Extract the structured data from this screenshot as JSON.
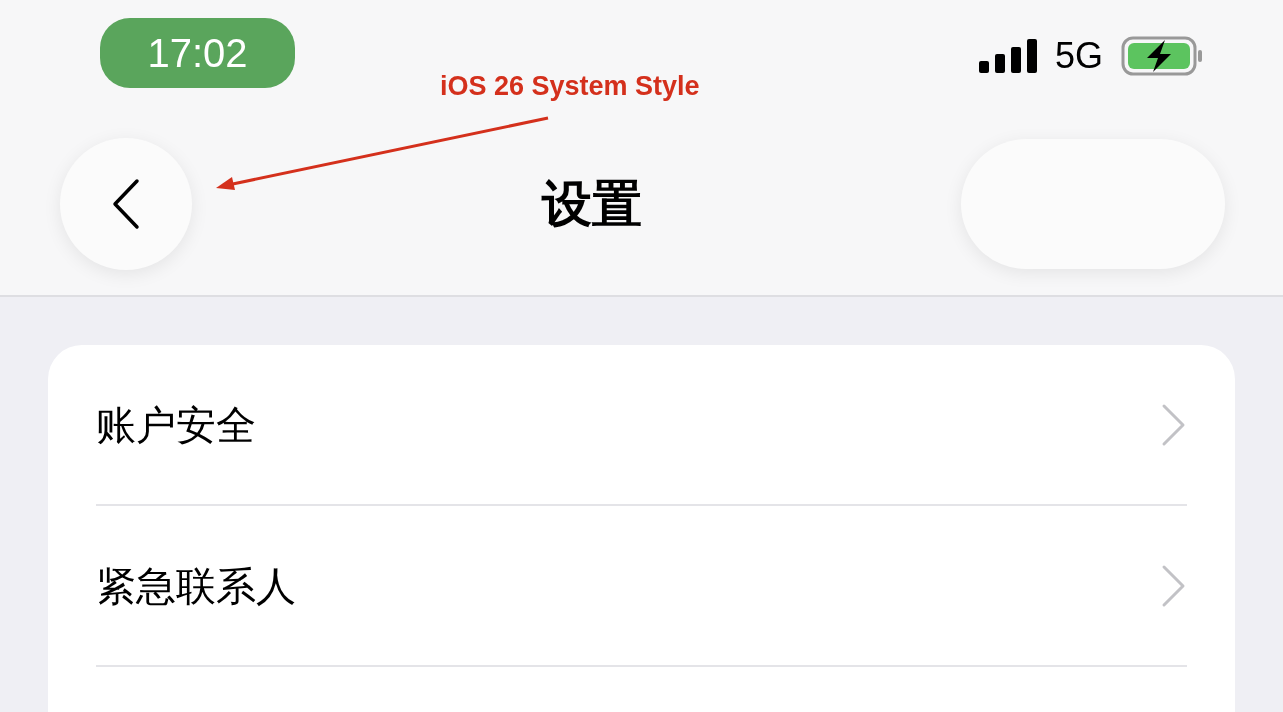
{
  "status_bar": {
    "time": "17:02",
    "network": "5G"
  },
  "annotation": {
    "text": "iOS 26 System Style"
  },
  "nav_bar": {
    "title": "设置"
  },
  "rows": [
    {
      "label": "账户安全"
    },
    {
      "label": "紧急联系人"
    }
  ]
}
